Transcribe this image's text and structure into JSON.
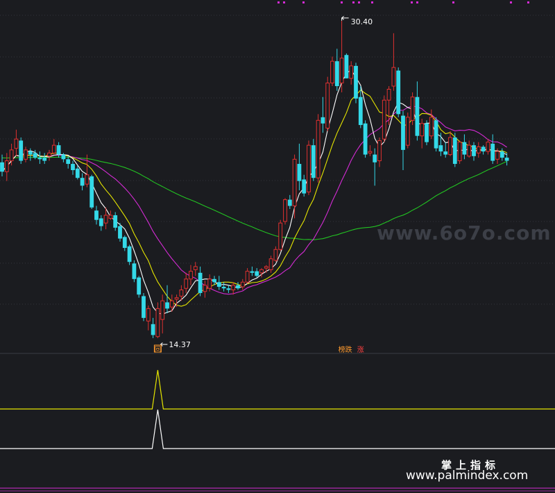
{
  "chart_data": [
    {
      "type": "candlestick",
      "panel": "main",
      "price_range": [
        10.4,
        31.2
      ],
      "grid": "horizontal dashed",
      "colors": {
        "up": "#e03030",
        "down": "#34d9e8",
        "ma5": "#ffffff",
        "ma10": "#e6e600",
        "ma20": "#d52bd5",
        "ma60": "#22c322"
      },
      "ohlc": [
        [
          21.3,
          21.8,
          20.4,
          20.7
        ],
        [
          20.7,
          21.9,
          20.1,
          21.4
        ],
        [
          21.4,
          22.5,
          21.1,
          22.1
        ],
        [
          22.2,
          23.4,
          21.7,
          22.8
        ],
        [
          22.7,
          22.9,
          21.2,
          21.4
        ],
        [
          21.5,
          22.3,
          21.3,
          22.1
        ],
        [
          22.0,
          22.2,
          21.4,
          21.8
        ],
        [
          21.9,
          22.1,
          21.5,
          21.6
        ],
        [
          21.6,
          22.0,
          21.2,
          21.5
        ],
        [
          21.6,
          21.9,
          21.2,
          21.4
        ],
        [
          21.7,
          22.1,
          21.4,
          21.9
        ],
        [
          21.9,
          22.8,
          21.8,
          22.4
        ],
        [
          22.4,
          22.6,
          21.6,
          21.8
        ],
        [
          21.8,
          21.9,
          21.3,
          21.5
        ],
        [
          21.5,
          21.7,
          20.9,
          21.2
        ],
        [
          21.2,
          21.4,
          20.5,
          20.8
        ],
        [
          20.9,
          21.1,
          20.2,
          20.3
        ],
        [
          20.3,
          20.6,
          19.5,
          19.8
        ],
        [
          19.9,
          21.8,
          19.7,
          20.5
        ],
        [
          20.4,
          20.5,
          18.3,
          18.4
        ],
        [
          18.2,
          18.5,
          17.3,
          17.6
        ],
        [
          17.7,
          17.9,
          16.9,
          17.2
        ],
        [
          17.4,
          18.4,
          17.0,
          17.9
        ],
        [
          17.7,
          18.2,
          17.6,
          17.9
        ],
        [
          17.9,
          18.1,
          16.9,
          17.1
        ],
        [
          17.2,
          17.4,
          16.2,
          16.4
        ],
        [
          16.5,
          16.6,
          15.6,
          15.8
        ],
        [
          15.9,
          16.0,
          14.7,
          14.9
        ],
        [
          14.8,
          15.0,
          13.6,
          13.8
        ],
        [
          13.9,
          14.0,
          12.6,
          12.8
        ],
        [
          12.7,
          12.9,
          11.1,
          11.3
        ],
        [
          11.1,
          12.1,
          10.5,
          11.9
        ],
        [
          10.9,
          11.3,
          10.0,
          10.2
        ],
        [
          10.1,
          12.3,
          10.0,
          11.9
        ],
        [
          11.2,
          12.8,
          10.3,
          12.4
        ],
        [
          12.3,
          13.4,
          11.6,
          11.9
        ],
        [
          12.0,
          12.8,
          11.7,
          12.4
        ],
        [
          12.5,
          12.8,
          12.0,
          12.6
        ],
        [
          12.7,
          13.4,
          12.4,
          13.1
        ],
        [
          13.2,
          14.2,
          12.9,
          13.8
        ],
        [
          13.8,
          14.7,
          13.4,
          14.3
        ],
        [
          14.4,
          14.9,
          14.0,
          14.6
        ],
        [
          14.2,
          14.6,
          12.7,
          12.9
        ],
        [
          13.0,
          13.7,
          12.6,
          13.4
        ],
        [
          13.2,
          14.1,
          13.0,
          13.8
        ],
        [
          13.8,
          14.0,
          13.4,
          13.6
        ],
        [
          13.6,
          14.0,
          13.1,
          13.3
        ],
        [
          13.3,
          13.6,
          13.0,
          13.2
        ],
        [
          13.2,
          13.4,
          12.9,
          13.1
        ],
        [
          13.1,
          13.6,
          12.8,
          13.4
        ],
        [
          13.4,
          13.6,
          13.1,
          13.2
        ],
        [
          13.3,
          13.8,
          13.1,
          13.6
        ],
        [
          13.6,
          14.5,
          13.5,
          14.3
        ],
        [
          14.3,
          14.6,
          14.0,
          14.2
        ],
        [
          14.3,
          14.5,
          13.9,
          14.0
        ],
        [
          14.2,
          14.5,
          13.9,
          14.4
        ],
        [
          14.5,
          14.7,
          14.2,
          14.6
        ],
        [
          14.4,
          15.3,
          14.2,
          15.1
        ],
        [
          15.0,
          15.9,
          14.9,
          15.7
        ],
        [
          15.7,
          17.6,
          15.6,
          17.4
        ],
        [
          17.5,
          19.0,
          17.3,
          18.9
        ],
        [
          18.9,
          19.2,
          18.3,
          18.5
        ],
        [
          18.5,
          21.8,
          17.7,
          21.5
        ],
        [
          21.2,
          22.5,
          19.5,
          20.1
        ],
        [
          20.2,
          20.5,
          19.1,
          19.3
        ],
        [
          19.4,
          22.7,
          19.2,
          22.4
        ],
        [
          22.4,
          22.8,
          20.1,
          20.3
        ],
        [
          20.3,
          24.4,
          20.0,
          24.0
        ],
        [
          24.2,
          25.5,
          23.2,
          23.8
        ],
        [
          23.5,
          26.8,
          23.3,
          26.4
        ],
        [
          26.4,
          28.1,
          26.2,
          27.8
        ],
        [
          27.8,
          28.6,
          25.9,
          26.2
        ],
        [
          26.4,
          30.4,
          25.8,
          28.0
        ],
        [
          28.2,
          28.3,
          26.7,
          26.7
        ],
        [
          26.7,
          27.8,
          26.3,
          27.5
        ],
        [
          27.5,
          27.7,
          25.1,
          25.4
        ],
        [
          25.5,
          26.2,
          23.5,
          23.7
        ],
        [
          23.8,
          24.0,
          21.6,
          21.8
        ],
        [
          21.9,
          22.4,
          21.7,
          22.0
        ],
        [
          21.8,
          22.2,
          19.8,
          21.3
        ],
        [
          21.4,
          22.9,
          21.0,
          22.7
        ],
        [
          22.8,
          25.6,
          22.6,
          25.3
        ],
        [
          25.3,
          26.2,
          23.7,
          26.0
        ],
        [
          26.2,
          29.6,
          25.9,
          27.4
        ],
        [
          27.2,
          27.4,
          24.2,
          24.4
        ],
        [
          24.3,
          24.6,
          20.8,
          22.1
        ],
        [
          22.4,
          24.5,
          22.2,
          24.2
        ],
        [
          24.0,
          25.8,
          23.7,
          25.5
        ],
        [
          25.5,
          26.5,
          22.7,
          23.0
        ],
        [
          23.0,
          24.1,
          22.2,
          23.8
        ],
        [
          23.8,
          24.0,
          22.4,
          22.6
        ],
        [
          23.0,
          24.7,
          22.8,
          24.2
        ],
        [
          24.0,
          24.2,
          22.0,
          22.2
        ],
        [
          22.4,
          23.2,
          21.7,
          22.0
        ],
        [
          22.0,
          22.6,
          21.6,
          21.8
        ],
        [
          21.8,
          23.3,
          21.7,
          22.9
        ],
        [
          22.9,
          23.2,
          21.0,
          21.2
        ],
        [
          21.4,
          22.7,
          21.2,
          22.6
        ],
        [
          22.6,
          23.1,
          21.5,
          21.8
        ],
        [
          21.7,
          22.7,
          21.6,
          22.4
        ],
        [
          22.4,
          22.6,
          21.4,
          21.7
        ],
        [
          21.9,
          22.6,
          21.6,
          22.3
        ],
        [
          22.3,
          22.4,
          21.8,
          22.0
        ],
        [
          22.0,
          22.8,
          21.8,
          22.6
        ],
        [
          22.5,
          23.1,
          21.2,
          21.4
        ],
        [
          21.5,
          22.2,
          21.2,
          22.0
        ],
        [
          22.0,
          22.2,
          21.4,
          21.6
        ],
        [
          21.6,
          21.9,
          21.1,
          21.4
        ]
      ],
      "annotations": [
        {
          "text": "14.37",
          "kind": "low",
          "index": 33
        },
        {
          "text": "30.40",
          "kind": "high",
          "index": 72
        }
      ],
      "markers": [
        {
          "text": "回",
          "index": 33,
          "color": "#ff9a2e"
        },
        {
          "text": "榜跌",
          "index": 72,
          "color": "#ff9a2e"
        },
        {
          "text": "涨",
          "index": 76,
          "color": "#ff4040"
        }
      ]
    },
    {
      "type": "line",
      "panel": "indicator",
      "series": [
        {
          "color": "#e6e600",
          "signal_index": 33,
          "base": 0,
          "peak": 1
        },
        {
          "color": "#ffffff",
          "signal_index": 33,
          "base": 0,
          "peak": 1
        }
      ]
    }
  ],
  "watermark": {
    "site1": "www.6o7o.com",
    "title": "掌上指标",
    "site2": "www.palmindex.com"
  }
}
